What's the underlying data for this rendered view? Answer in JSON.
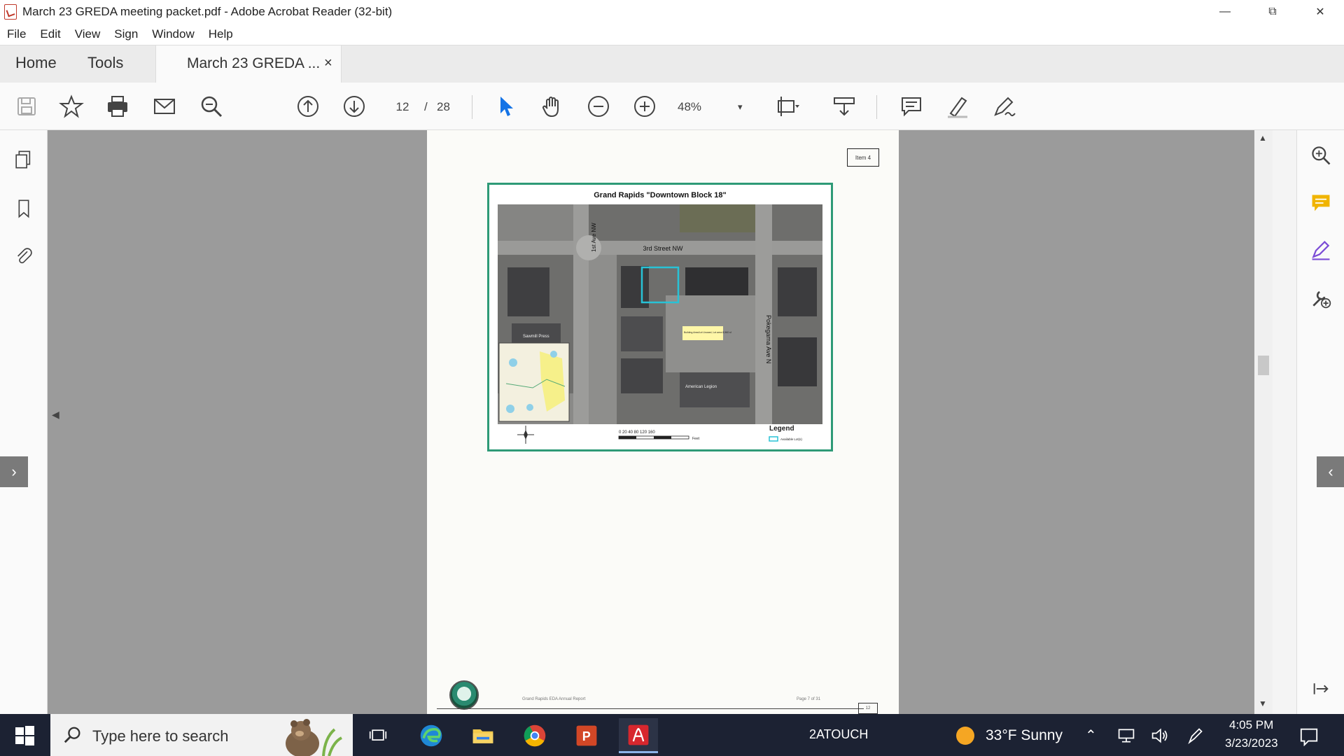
{
  "window": {
    "title": "March 23 GREDA meeting packet.pdf - Adobe Acrobat Reader (32-bit)",
    "minimize": "—",
    "restore": "⧉",
    "close": "✕"
  },
  "menu": [
    "File",
    "Edit",
    "View",
    "Sign",
    "Window",
    "Help"
  ],
  "tabs": {
    "home": "Home",
    "tools": "Tools",
    "document": "March 23 GREDA ...",
    "close": "×"
  },
  "toolbar": {
    "current_page": "12",
    "separator": "/",
    "total_pages": "28",
    "zoom": "48%",
    "zoom_caret": "▾"
  },
  "document": {
    "item_badge": "Item 4",
    "map_title": "Grand Rapids \"Downtown Block 18\"",
    "map_labels": {
      "street_3rd": "3rd Street NW",
      "ave_1st": "1st Ave NW",
      "pokegama": "Pokegama Ave N",
      "callout": "Building Area/Lot Unused, Lot area 8,960 sf",
      "sawmill": "Sawmill Press",
      "american": "American Legion"
    },
    "legend_title": "Legend",
    "legend_entry": "Available Lot(s)",
    "scale_labels": "0  20  40   80   120   160",
    "scale_unit": "Feet",
    "footer_left": "Grand Rapids EDA Annual Report",
    "footer_right": "Page 7 of 31",
    "footer_page": "12"
  },
  "taskbar": {
    "search_placeholder": "Type here to search",
    "tray_label": "2ATOUCH",
    "weather": "33°F  Sunny",
    "time": "4:05 PM",
    "date": "3/23/2023"
  },
  "colors": {
    "acrobat_red": "#d7272e",
    "select_blue": "#1473e6",
    "comment_yellow": "#f0b400",
    "sign_purple": "#7b4bd6",
    "map_frame": "#2e9a77",
    "taskbar_bg": "#1c2233"
  }
}
